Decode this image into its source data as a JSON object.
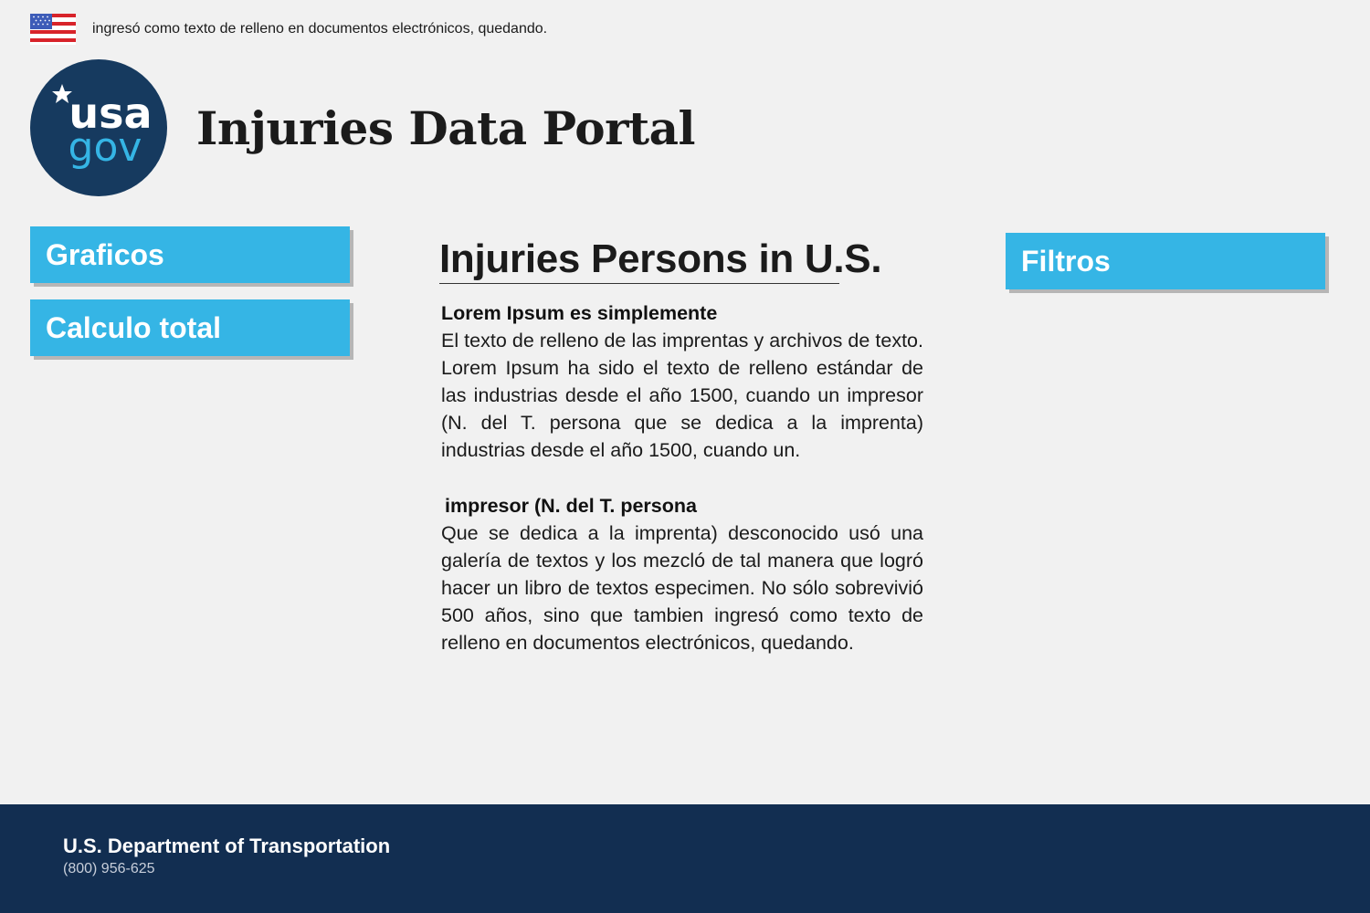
{
  "banner": {
    "text": "ingresó como texto de relleno en documentos electrónicos, quedando.",
    "icon": "us-flag-icon"
  },
  "header": {
    "logo_text": [
      "usa",
      "gov"
    ],
    "title": "Injuries Data Portal"
  },
  "sidebar": {
    "items": [
      {
        "label": "Graficos"
      },
      {
        "label": "Calculo total"
      }
    ]
  },
  "filters": {
    "label": "Filtros"
  },
  "main": {
    "title": "Injuries Persons in U.S.",
    "sections": [
      {
        "heading": "Lorem Ipsum es simplemente",
        "body": "El texto de relleno de las imprentas y archivos de texto. Lorem Ipsum ha sido el texto de relleno estándar de las industrias desde el año 1500, cuando un impresor (N. del T. persona que se dedica a la imprenta)  industrias desde el año 1500, cuando un."
      },
      {
        "heading": "impresor (N. del T. persona",
        "body": "Que se dedica a la imprenta) desconocido usó una galería de textos y los mezcló de tal manera que logró hacer un libro de textos especimen. No sólo sobrevivió 500 años, sino que tambien ingresó como texto de relleno en documentos electrónicos, quedando."
      }
    ]
  },
  "footer": {
    "org": "U.S. Department of Transportation",
    "phone": "(800) 956-625"
  },
  "colors": {
    "accent": "#35b5e5",
    "footer_bg": "#122e51",
    "logo_bg": "#163a5f",
    "logo_accent": "#35b5e5",
    "page_bg": "#f1f1f1"
  }
}
